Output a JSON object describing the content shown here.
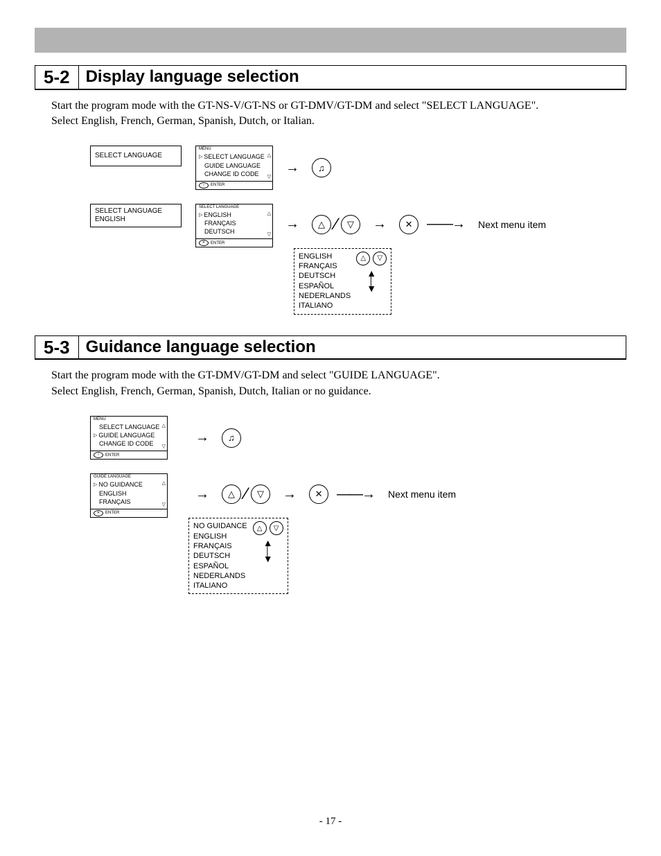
{
  "sections": {
    "s52": {
      "num": "5-2",
      "title": "Display language selection",
      "intro_l1": "Start the program mode with the GT-NS-V/GT-NS or GT-DMV/GT-DM and select \"SELECT LANGUAGE\".",
      "intro_l2": "Select English, French, German, Spanish, Dutch, or Italian.",
      "row1_label": "SELECT LANGUAGE",
      "row1_screen_header": "MENU",
      "row1_screen_items": [
        "SELECT LANGUAGE",
        "GUIDE LANGUAGE",
        "CHANGE ID CODE"
      ],
      "row1_screen_footer_sym": "○",
      "row1_screen_footer": "ENTER",
      "row2_label_l1": "SELECT LANGUAGE",
      "row2_label_l2": "ENGLISH",
      "row2_screen_header": "SELECT LANGUAGE",
      "row2_screen_items": [
        "ENGLISH",
        "FRANÇAIS",
        "DEUTSCH"
      ],
      "row2_screen_footer_sym": "✕",
      "row2_screen_footer": "ENTER",
      "next_label": "Next menu item",
      "options_list": [
        "ENGLISH",
        "FRANÇAIS",
        "DEUTSCH",
        "ESPAÑOL",
        "NEDERLANDS",
        "ITALIANO"
      ]
    },
    "s53": {
      "num": "5-3",
      "title": "Guidance language selection",
      "intro_l1": "Start the program mode with the GT-DMV/GT-DM and select \"GUIDE LANGUAGE\".",
      "intro_l2": "Select English, French, German, Spanish, Dutch, Italian or no guidance.",
      "row1_screen_header": "MENU",
      "row1_screen_items": [
        "SELECT LANGUAGE",
        "GUIDE LANGUAGE",
        "CHANGE ID CODE"
      ],
      "row1_screen_footer_sym": "○",
      "row1_screen_footer": "ENTER",
      "row2_screen_header": "GUIDE LANGUAGE",
      "row2_screen_items": [
        "NO GUIDANCE",
        "ENGLISH",
        "FRANÇAIS"
      ],
      "row2_screen_footer_sym": "✕",
      "row2_screen_footer": "ENTER",
      "next_label": "Next menu item",
      "options_list": [
        "NO GUIDANCE",
        "ENGLISH",
        "FRANÇAIS",
        "DEUTSCH",
        "ESPAÑOL",
        "NEDERLANDS",
        "ITALIANO"
      ]
    }
  },
  "icons": {
    "bell": "♫",
    "tri_up": "△",
    "tri_dn": "▽",
    "x": "✕"
  },
  "page_number": "- 17 -"
}
